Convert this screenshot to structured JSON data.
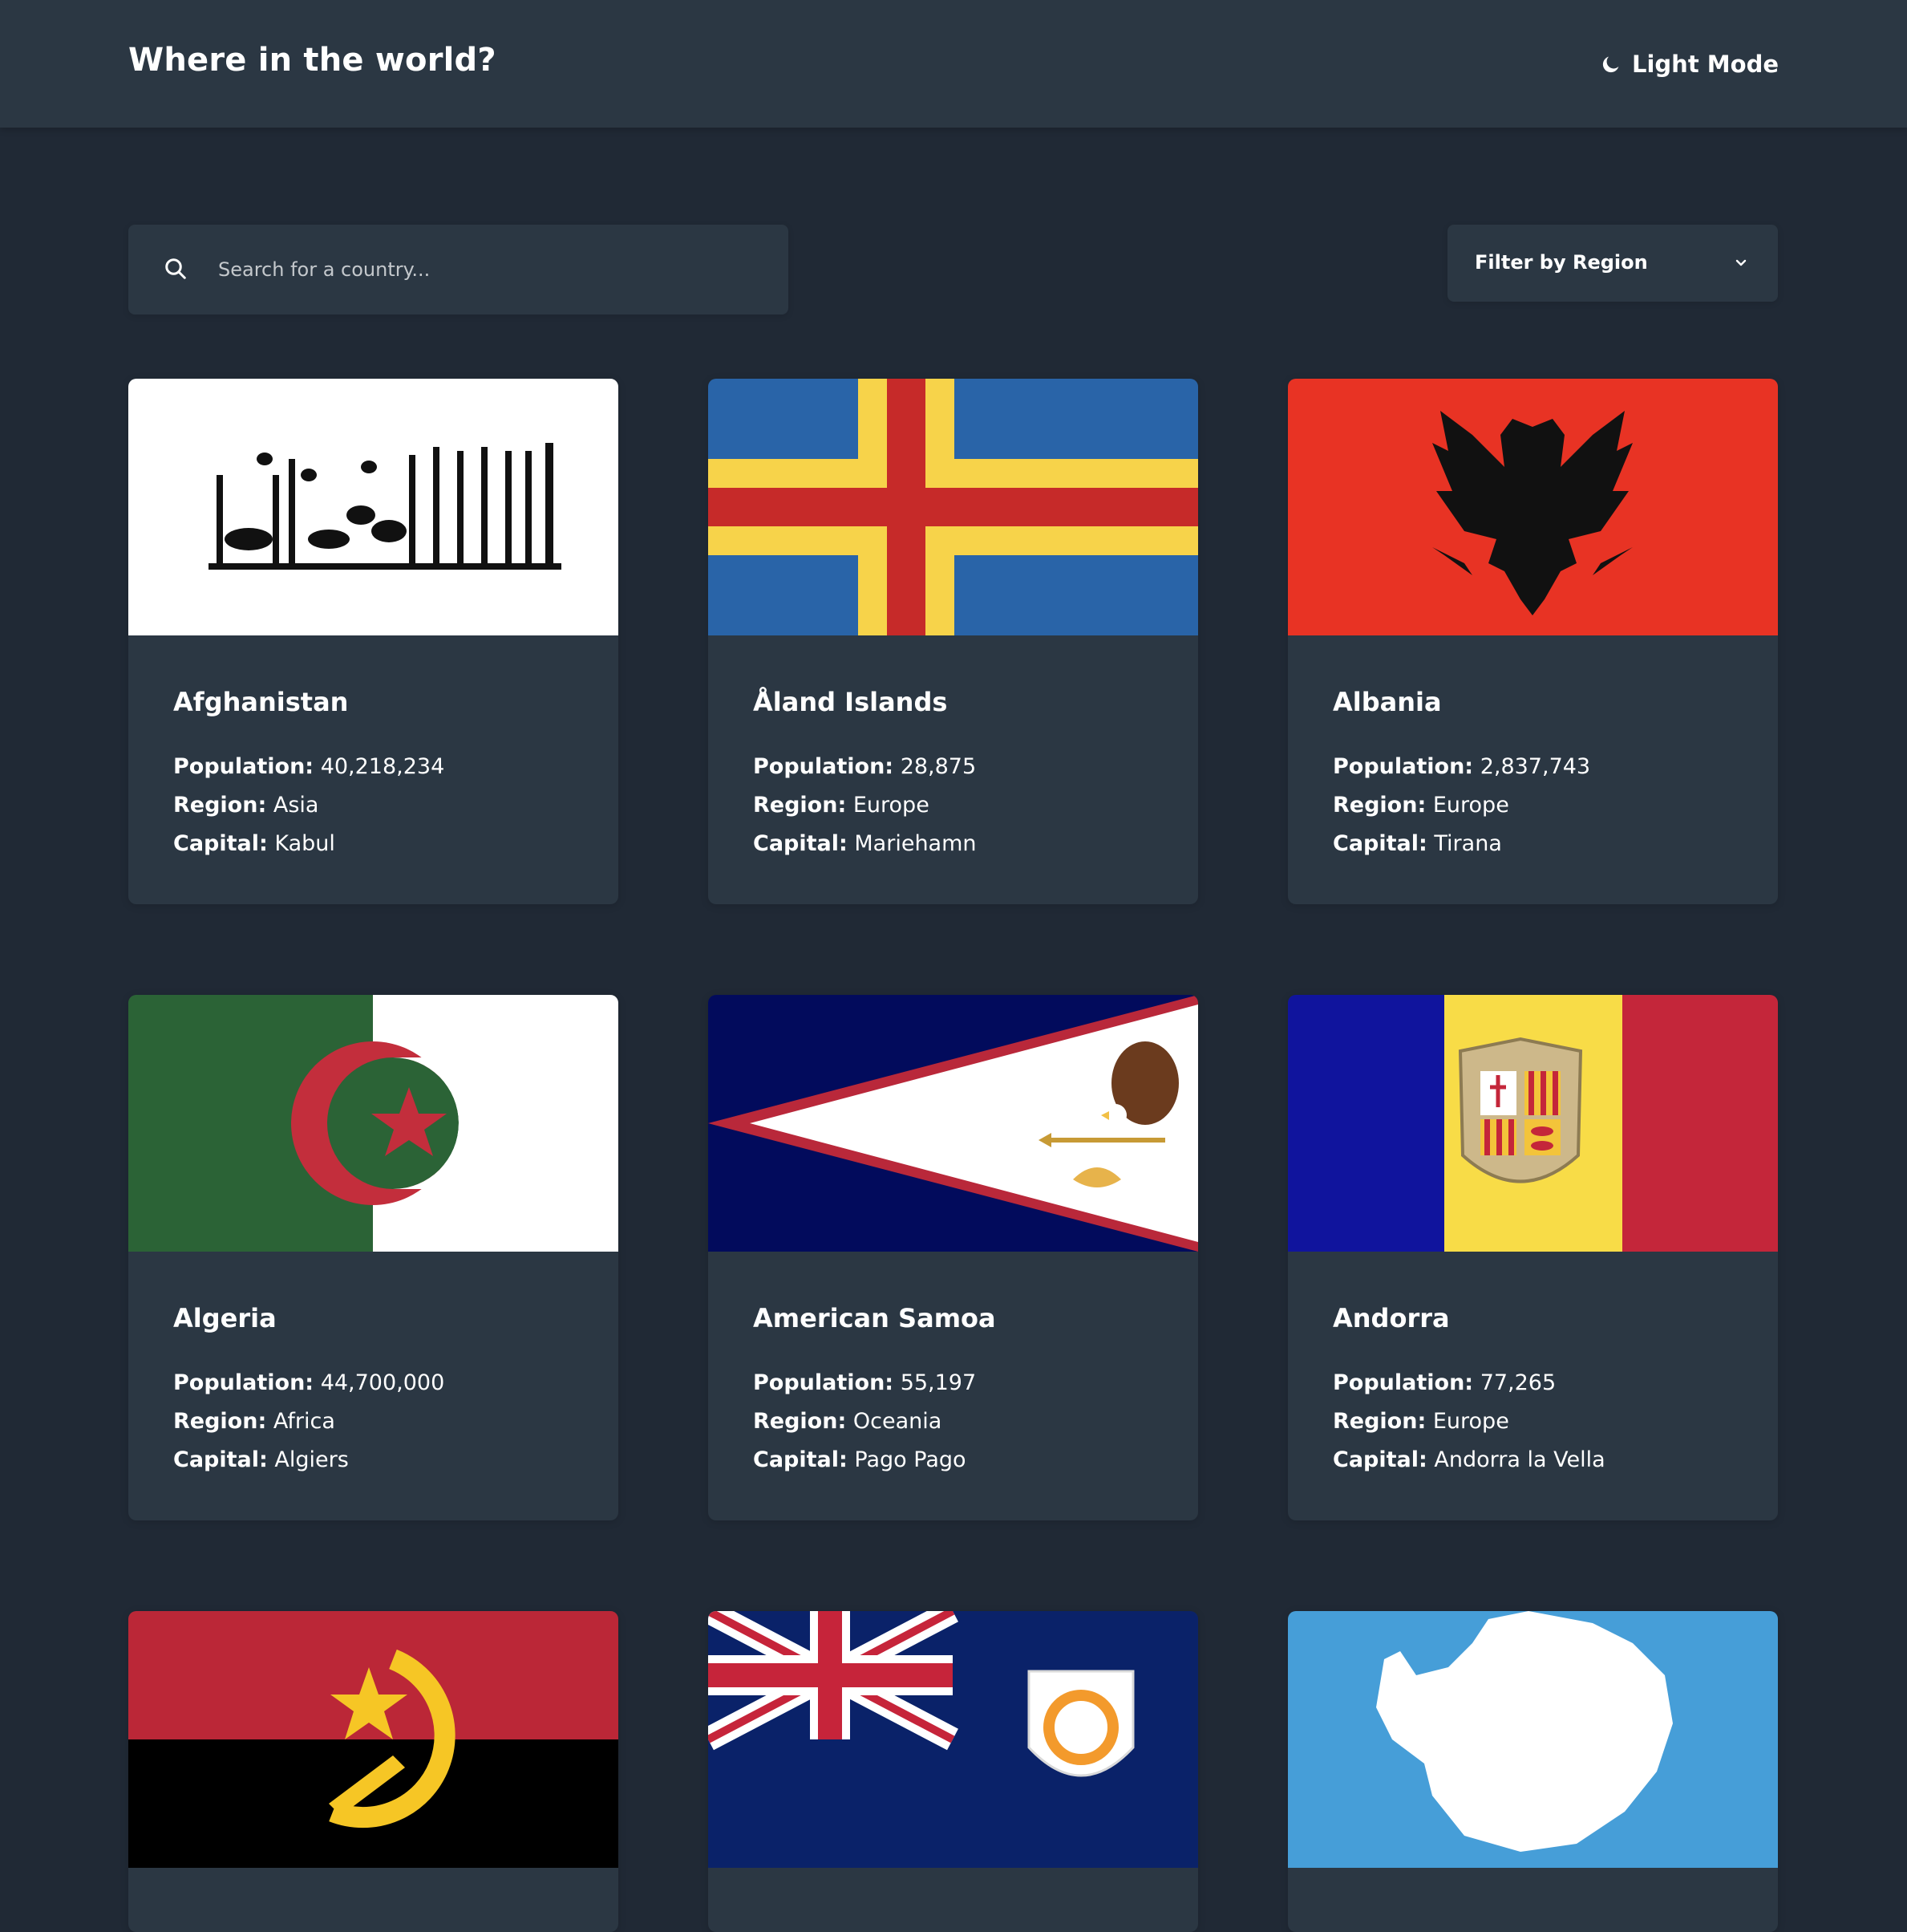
{
  "header": {
    "title": "Where in the world?",
    "mode_toggle_label": "Light Mode",
    "mode_icon": "moon-icon"
  },
  "search": {
    "placeholder": "Search for a country...",
    "value": "",
    "icon": "search-icon"
  },
  "filter": {
    "label": "Filter by Region",
    "icon": "chevron-down-icon"
  },
  "labels": {
    "population": "Population:",
    "region": "Region:",
    "capital": "Capital:"
  },
  "countries": [
    {
      "name": "Afghanistan",
      "population": "40,218,234",
      "region": "Asia",
      "capital": "Kabul",
      "flag": "afghanistan-flag"
    },
    {
      "name": "Åland Islands",
      "population": "28,875",
      "region": "Europe",
      "capital": "Mariehamn",
      "flag": "aland-islands-flag"
    },
    {
      "name": "Albania",
      "population": "2,837,743",
      "region": "Europe",
      "capital": "Tirana",
      "flag": "albania-flag"
    },
    {
      "name": "Algeria",
      "population": "44,700,000",
      "region": "Africa",
      "capital": "Algiers",
      "flag": "algeria-flag"
    },
    {
      "name": "American Samoa",
      "population": "55,197",
      "region": "Oceania",
      "capital": "Pago Pago",
      "flag": "american-samoa-flag"
    },
    {
      "name": "Andorra",
      "population": "77,265",
      "region": "Europe",
      "capital": "Andorra la Vella",
      "flag": "andorra-flag"
    },
    {
      "flag": "angola-flag"
    },
    {
      "flag": "anguilla-flag"
    },
    {
      "flag": "antarctica-flag"
    }
  ],
  "colors": {
    "background": "#202935",
    "element": "#2b3743",
    "text": "#ffffff"
  }
}
